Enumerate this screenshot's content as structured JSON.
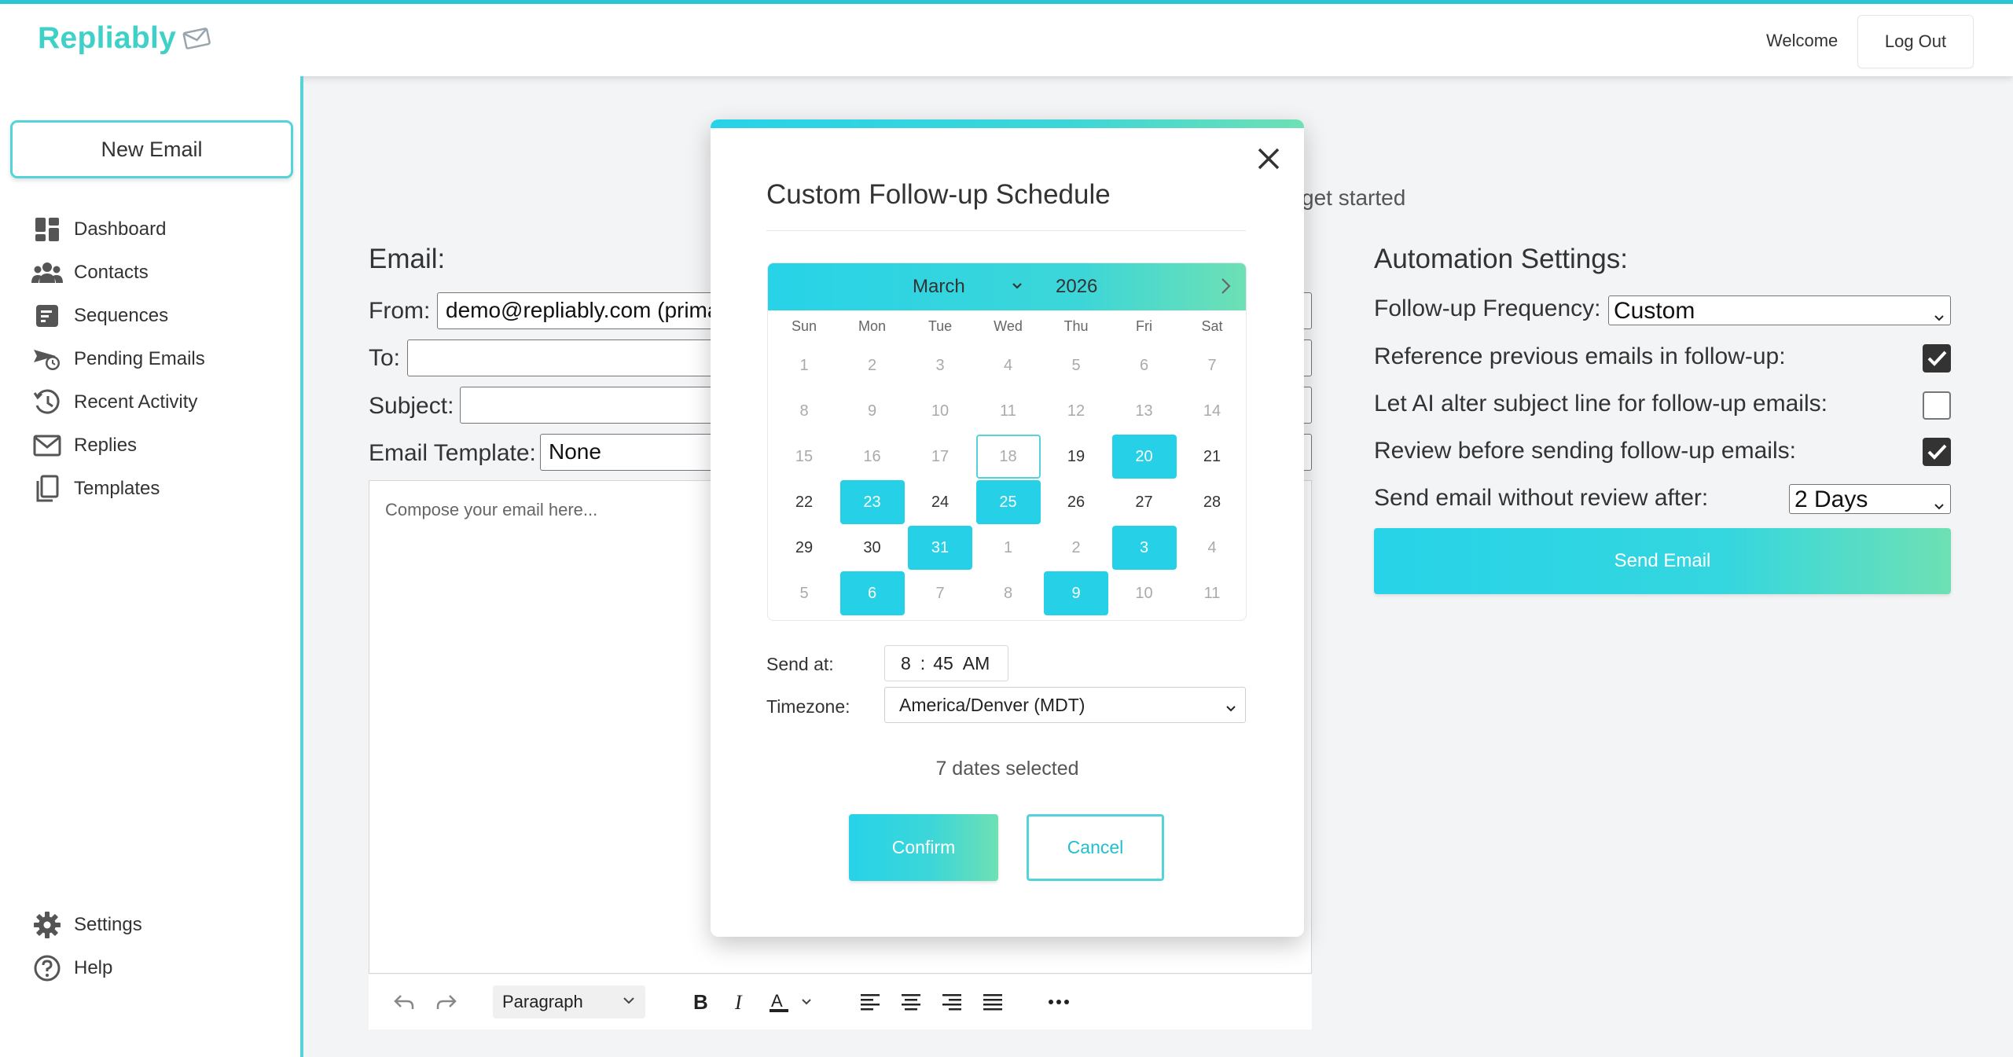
{
  "app": {
    "brand": "Repliably",
    "welcome": "Welcome",
    "logout_label": "Log Out",
    "accent_color": "#2bc8d3"
  },
  "sidebar": {
    "new_email_label": "New Email",
    "items": [
      {
        "label": "Dashboard",
        "icon": "dashboard-icon"
      },
      {
        "label": "Contacts",
        "icon": "contacts-icon"
      },
      {
        "label": "Sequences",
        "icon": "sequences-icon"
      },
      {
        "label": "Pending Emails",
        "icon": "pending-emails-icon"
      },
      {
        "label": "Recent Activity",
        "icon": "recent-activity-icon"
      },
      {
        "label": "Replies",
        "icon": "envelope-icon"
      },
      {
        "label": "Templates",
        "icon": "templates-icon"
      }
    ],
    "bottom_items": [
      {
        "label": "Settings",
        "icon": "gear-icon"
      },
      {
        "label": "Help",
        "icon": "help-icon"
      }
    ]
  },
  "main": {
    "hint_text": "get started",
    "email_title": "Email:",
    "from_label": "From:",
    "from_value": "demo@repliably.com (prima",
    "to_label": "To:",
    "to_value": "",
    "subject_label": "Subject:",
    "subject_value": "",
    "template_label": "Email Template:",
    "template_value": "None",
    "compose_placeholder": "Compose your email here...",
    "toolbar": {
      "block_format": "Paragraph"
    }
  },
  "automation": {
    "title": "Automation Settings:",
    "frequency_label": "Follow-up Frequency:",
    "frequency_value": "Custom",
    "reference_label": "Reference previous emails in follow-up:",
    "reference_checked": true,
    "ai_subject_label": "Let AI alter subject line for follow-up emails:",
    "ai_subject_checked": false,
    "review_label": "Review before sending follow-up emails:",
    "review_checked": true,
    "send_without_review_label": "Send email without review after:",
    "send_without_review_value": "2 Days",
    "send_button_label": "Send Email"
  },
  "modal": {
    "title": "Custom Follow-up Schedule",
    "calendar": {
      "month": "March",
      "year": "2026",
      "weekdays": [
        "Sun",
        "Mon",
        "Tue",
        "Wed",
        "Thu",
        "Fri",
        "Sat"
      ],
      "weeks": [
        [
          {
            "d": "1",
            "m": 1
          },
          {
            "d": "2",
            "m": 1
          },
          {
            "d": "3",
            "m": 1
          },
          {
            "d": "4",
            "m": 1
          },
          {
            "d": "5",
            "m": 1
          },
          {
            "d": "6",
            "m": 1
          },
          {
            "d": "7",
            "m": 1
          }
        ],
        [
          {
            "d": "8",
            "m": 1
          },
          {
            "d": "9",
            "m": 1
          },
          {
            "d": "10",
            "m": 1
          },
          {
            "d": "11",
            "m": 1
          },
          {
            "d": "12",
            "m": 1
          },
          {
            "d": "13",
            "m": 1
          },
          {
            "d": "14",
            "m": 1
          }
        ],
        [
          {
            "d": "15",
            "m": 1
          },
          {
            "d": "16",
            "m": 1
          },
          {
            "d": "17",
            "m": 1
          },
          {
            "d": "18",
            "m": 1,
            "today": 1
          },
          {
            "d": "19"
          },
          {
            "d": "20",
            "s": 1
          },
          {
            "d": "21"
          }
        ],
        [
          {
            "d": "22"
          },
          {
            "d": "23",
            "s": 1
          },
          {
            "d": "24"
          },
          {
            "d": "25",
            "s": 1
          },
          {
            "d": "26"
          },
          {
            "d": "27"
          },
          {
            "d": "28"
          }
        ],
        [
          {
            "d": "29"
          },
          {
            "d": "30"
          },
          {
            "d": "31",
            "s": 1
          },
          {
            "d": "1",
            "m": 1
          },
          {
            "d": "2",
            "m": 1
          },
          {
            "d": "3",
            "s": 1
          },
          {
            "d": "4",
            "m": 1
          }
        ],
        [
          {
            "d": "5",
            "m": 1
          },
          {
            "d": "6",
            "s": 1
          },
          {
            "d": "7",
            "m": 1
          },
          {
            "d": "8",
            "m": 1
          },
          {
            "d": "9",
            "s": 1
          },
          {
            "d": "10",
            "m": 1
          },
          {
            "d": "11",
            "m": 1
          }
        ]
      ]
    },
    "send_at_label": "Send at:",
    "send_at_hour": "8",
    "send_at_sep": ":",
    "send_at_minute": "45",
    "send_at_ampm": "AM",
    "timezone_label": "Timezone:",
    "timezone_value": "America/Denver (MDT)",
    "dates_selected": "7 dates selected",
    "confirm_label": "Confirm",
    "cancel_label": "Cancel"
  }
}
